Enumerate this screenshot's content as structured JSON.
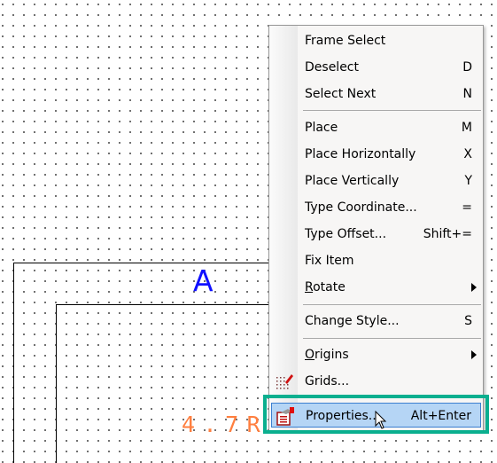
{
  "canvas": {
    "labels": {
      "ref": "A",
      "value": "4.7R"
    },
    "colors": {
      "ref": "#1010ff",
      "value": "#ff7f3f",
      "highlight_box": "#0aaf8f"
    }
  },
  "context_menu": {
    "items": [
      {
        "label": "Frame Select",
        "shortcut": ""
      },
      {
        "label": "Deselect",
        "shortcut": "D"
      },
      {
        "label": "Select Next",
        "shortcut": "N"
      },
      {
        "label": "Place",
        "shortcut": "M"
      },
      {
        "label": "Place Horizontally",
        "shortcut": "X"
      },
      {
        "label": "Place Vertically",
        "shortcut": "Y"
      },
      {
        "label": "Type Coordinate...",
        "shortcut": "="
      },
      {
        "label": "Type Offset...",
        "shortcut": "Shift+="
      },
      {
        "label": "Fix Item",
        "shortcut": ""
      },
      {
        "label_underline": "R",
        "label_rest": "otate",
        "submenu": true
      },
      {
        "label": "Change Style...",
        "shortcut": "S"
      },
      {
        "label_underline": "O",
        "label_rest": "rigins",
        "submenu": true
      },
      {
        "label": "Grids...",
        "icon": "grid-pencil-icon"
      },
      {
        "label": "Properties...",
        "shortcut": "Alt+Enter",
        "icon": "properties-icon",
        "highlighted": true
      }
    ]
  }
}
